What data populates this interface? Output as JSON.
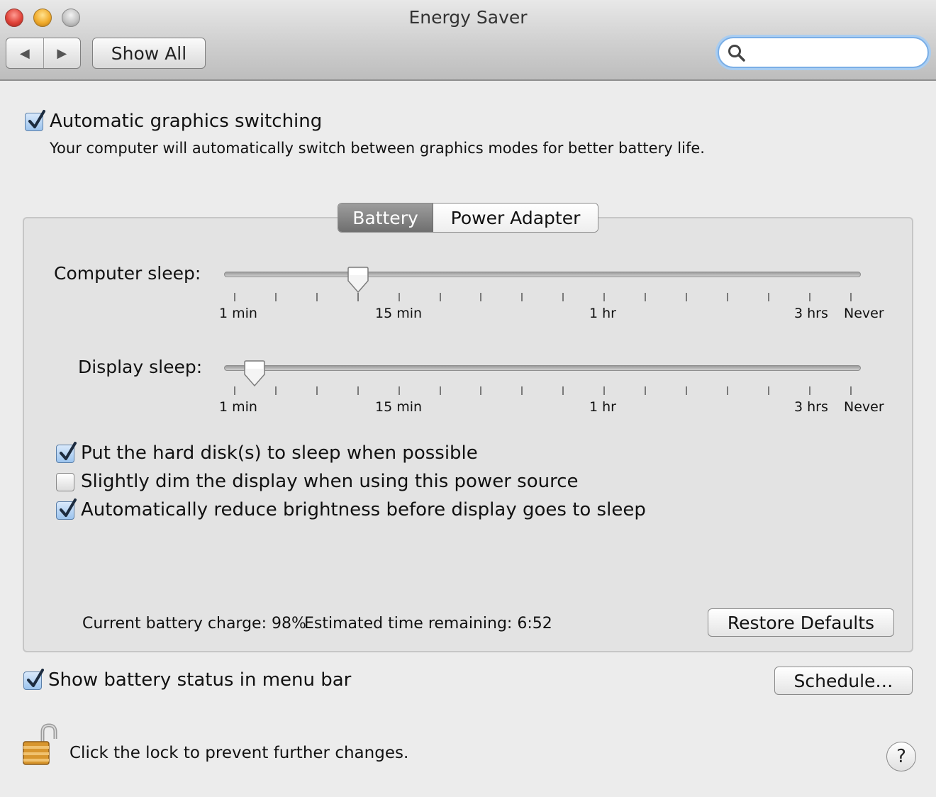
{
  "window": {
    "title": "Energy Saver"
  },
  "toolbar": {
    "back_glyph": "◀",
    "forward_glyph": "▶",
    "show_all_label": "Show All",
    "search_value": "",
    "search_placeholder": ""
  },
  "graphics_switching": {
    "checked": true,
    "label": "Automatic graphics switching",
    "description": "Your computer will automatically switch between graphics modes for better battery life."
  },
  "tabs": [
    {
      "label": "Battery",
      "selected": true
    },
    {
      "label": "Power Adapter",
      "selected": false
    }
  ],
  "computer_sleep": {
    "label": "Computer sleep:",
    "value": "10 min",
    "tick_labels": [
      "1 min",
      "15 min",
      "1 hr",
      "3 hrs",
      "Never"
    ]
  },
  "display_sleep": {
    "label": "Display sleep:",
    "value": "2 min",
    "tick_labels": [
      "1 min",
      "15 min",
      "1 hr",
      "3 hrs",
      "Never"
    ]
  },
  "options": [
    {
      "label": "Put the hard disk(s) to sleep when possible",
      "checked": true
    },
    {
      "label": "Slightly dim the display when using this power source",
      "checked": false
    },
    {
      "label": "Automatically reduce brightness before display goes to sleep",
      "checked": true
    }
  ],
  "battery_status": {
    "charge_text": "Current battery charge: 98%",
    "remaining_text": "Estimated time remaining: 6:52"
  },
  "restore_defaults_label": "Restore Defaults",
  "show_battery_status": {
    "label": "Show battery status in menu bar",
    "checked": true
  },
  "schedule_label": "Schedule…",
  "lock": {
    "label": "Click the lock to prevent further changes.",
    "state": "unlocked",
    "icon": "padlock-open-icon"
  },
  "help_label": "?",
  "colors": {
    "accent": "#5b8fd0",
    "selected_tab": "#7f7f7f"
  }
}
